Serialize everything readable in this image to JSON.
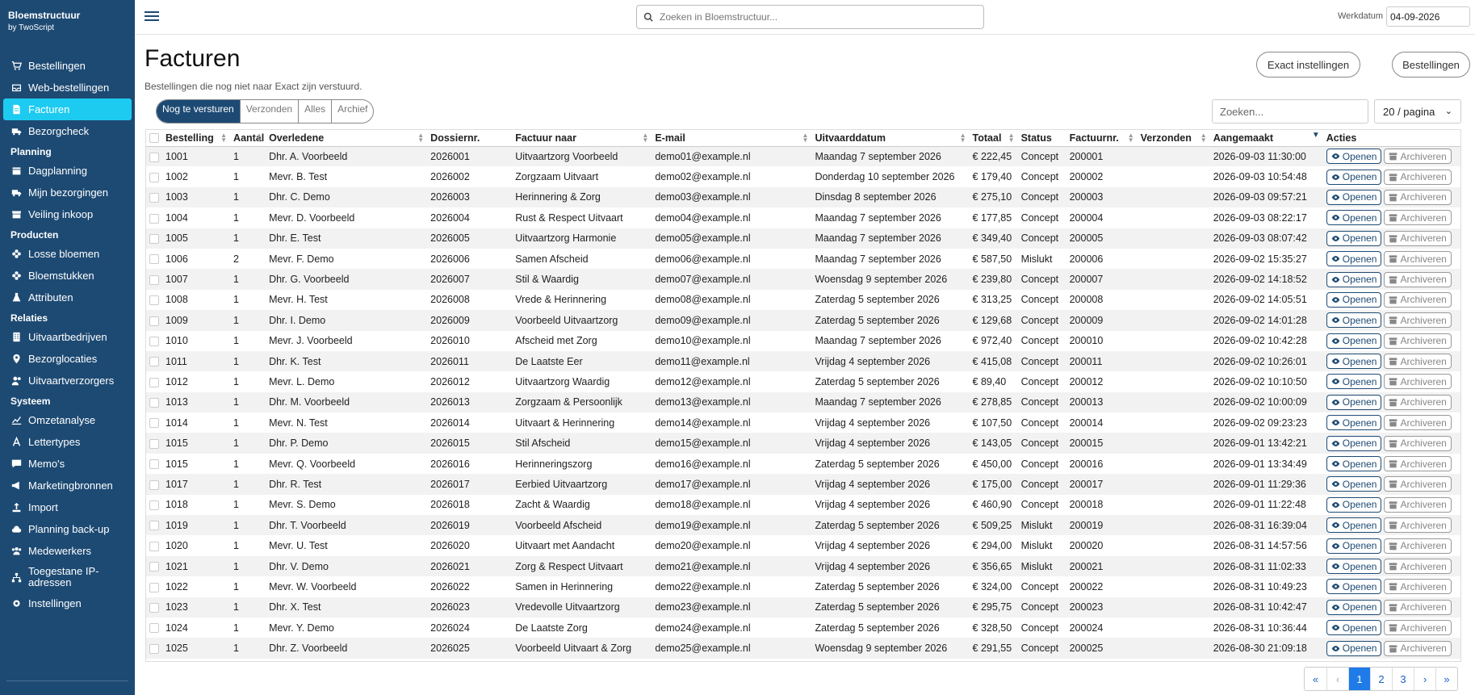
{
  "brand": {
    "name": "Bloemstructuur",
    "sub": "by TwoScript"
  },
  "nav": {
    "top": [
      {
        "label": "Bestellingen"
      },
      {
        "label": "Web-bestellingen"
      },
      {
        "label": "Facturen"
      },
      {
        "label": "Bezorgcheck"
      }
    ],
    "planning_title": "Planning",
    "planning": [
      {
        "label": "Dagplanning"
      },
      {
        "label": "Mijn bezorgingen"
      },
      {
        "label": "Veiling inkoop"
      }
    ],
    "producten_title": "Producten",
    "producten": [
      {
        "label": "Losse bloemen"
      },
      {
        "label": "Bloemstukken"
      },
      {
        "label": "Attributen"
      }
    ],
    "relaties_title": "Relaties",
    "relaties": [
      {
        "label": "Uitvaartbedrijven"
      },
      {
        "label": "Bezorglocaties"
      },
      {
        "label": "Uitvaartverzorgers"
      }
    ],
    "systeem_title": "Systeem",
    "systeem": [
      {
        "label": "Omzetanalyse"
      },
      {
        "label": "Lettertypes"
      },
      {
        "label": "Memo's"
      },
      {
        "label": "Marketingbronnen"
      },
      {
        "label": "Import"
      },
      {
        "label": "Planning back-up"
      },
      {
        "label": "Medewerkers"
      },
      {
        "label": "Toegestane IP-adressen"
      },
      {
        "label": "Instellingen"
      }
    ]
  },
  "topbar": {
    "search_placeholder": "Zoeken in Bloemstructuur...",
    "werkdatum_label": "Werkdatum",
    "werkdatum_value": "04-09-2026"
  },
  "page": {
    "title": "Facturen",
    "subtitle": "Bestellingen die nog niet naar Exact zijn verstuurd.",
    "btn_exact": "Exact instellingen",
    "btn_bestellingen": "Bestellingen"
  },
  "tabs": [
    "Nog te versturen",
    "Verzonden",
    "Alles",
    "Archief"
  ],
  "table_search_placeholder": "Zoeken...",
  "per_page": "20 / pagina",
  "columns": [
    "Bestelling",
    "Aantal",
    "Overledene",
    "Dossiernr.",
    "Factuur naar",
    "E-mail",
    "Uitvaarddatum",
    "Totaal",
    "Status",
    "Factuurnr.",
    "Verzonden",
    "Aangemaakt",
    "Acties"
  ],
  "actions": {
    "open": "Openen",
    "archive": "Archiveren"
  },
  "rows": [
    [
      "1001",
      "1",
      "Dhr. A. Voorbeeld",
      "2026001",
      "Uitvaartzorg Voorbeeld",
      "demo01@example.nl",
      "Maandag 7 september 2026",
      "€ 222,45",
      "Concept",
      "200001",
      "",
      "2026-09-03 11:30:00"
    ],
    [
      "1002",
      "1",
      "Mevr. B. Test",
      "2026002",
      "Zorgzaam Uitvaart",
      "demo02@example.nl",
      "Donderdag 10 september 2026",
      "€ 179,40",
      "Concept",
      "200002",
      "",
      "2026-09-03 10:54:48"
    ],
    [
      "1003",
      "1",
      "Dhr. C. Demo",
      "2026003",
      "Herinnering & Zorg",
      "demo03@example.nl",
      "Dinsdag 8 september 2026",
      "€ 275,10",
      "Concept",
      "200003",
      "",
      "2026-09-03 09:57:21"
    ],
    [
      "1004",
      "1",
      "Mevr. D. Voorbeeld",
      "2026004",
      "Rust & Respect Uitvaart",
      "demo04@example.nl",
      "Maandag 7 september 2026",
      "€ 177,85",
      "Concept",
      "200004",
      "",
      "2026-09-03 08:22:17"
    ],
    [
      "1005",
      "1",
      "Dhr. E. Test",
      "2026005",
      "Uitvaartzorg Harmonie",
      "demo05@example.nl",
      "Maandag 7 september 2026",
      "€ 349,40",
      "Concept",
      "200005",
      "",
      "2026-09-03 08:07:42"
    ],
    [
      "1006",
      "2",
      "Mevr. F. Demo",
      "2026006",
      "Samen Afscheid",
      "demo06@example.nl",
      "Maandag 7 september 2026",
      "€ 587,50",
      "Mislukt",
      "200006",
      "",
      "2026-09-02 15:35:27"
    ],
    [
      "1007",
      "1",
      "Dhr. G. Voorbeeld",
      "2026007",
      "Stil & Waardig",
      "demo07@example.nl",
      "Woensdag 9 september 2026",
      "€ 239,80",
      "Concept",
      "200007",
      "",
      "2026-09-02 14:18:52"
    ],
    [
      "1008",
      "1",
      "Mevr. H. Test",
      "2026008",
      "Vrede & Herinnering",
      "demo08@example.nl",
      "Zaterdag 5 september 2026",
      "€ 313,25",
      "Concept",
      "200008",
      "",
      "2026-09-02 14:05:51"
    ],
    [
      "1009",
      "1",
      "Dhr. I. Demo",
      "2026009",
      "Voorbeeld Uitvaartzorg",
      "demo09@example.nl",
      "Zaterdag 5 september 2026",
      "€ 129,68",
      "Concept",
      "200009",
      "",
      "2026-09-02 14:01:28"
    ],
    [
      "1010",
      "1",
      "Mevr. J. Voorbeeld",
      "2026010",
      "Afscheid met Zorg",
      "demo10@example.nl",
      "Maandag 7 september 2026",
      "€ 972,40",
      "Concept",
      "200010",
      "",
      "2026-09-02 10:42:28"
    ],
    [
      "1011",
      "1",
      "Dhr. K. Test",
      "2026011",
      "De Laatste Eer",
      "demo11@example.nl",
      "Vrijdag 4 september 2026",
      "€ 415,08",
      "Concept",
      "200011",
      "",
      "2026-09-02 10:26:01"
    ],
    [
      "1012",
      "1",
      "Mevr. L. Demo",
      "2026012",
      "Uitvaartzorg Waardig",
      "demo12@example.nl",
      "Zaterdag 5 september 2026",
      "€ 89,40",
      "Concept",
      "200012",
      "",
      "2026-09-02 10:10:50"
    ],
    [
      "1013",
      "1",
      "Dhr. M. Voorbeeld",
      "2026013",
      "Zorgzaam & Persoonlijk",
      "demo13@example.nl",
      "Maandag 7 september 2026",
      "€ 278,85",
      "Concept",
      "200013",
      "",
      "2026-09-02 10:00:09"
    ],
    [
      "1014",
      "1",
      "Mevr. N. Test",
      "2026014",
      "Uitvaart & Herinnering",
      "demo14@example.nl",
      "Vrijdag 4 september 2026",
      "€ 107,50",
      "Concept",
      "200014",
      "",
      "2026-09-02 09:23:23"
    ],
    [
      "1015",
      "1",
      "Dhr. P. Demo",
      "2026015",
      "Stil Afscheid",
      "demo15@example.nl",
      "Vrijdag 4 september 2026",
      "€ 143,05",
      "Concept",
      "200015",
      "",
      "2026-09-01 13:42:21"
    ],
    [
      "1015",
      "1",
      "Mevr. Q. Voorbeeld",
      "2026016",
      "Herinneringszorg",
      "demo16@example.nl",
      "Zaterdag 5 september 2026",
      "€ 450,00",
      "Concept",
      "200016",
      "",
      "2026-09-01 13:34:49"
    ],
    [
      "1017",
      "1",
      "Dhr. R. Test",
      "2026017",
      "Eerbied Uitvaartzorg",
      "demo17@example.nl",
      "Vrijdag 4 september 2026",
      "€ 175,00",
      "Concept",
      "200017",
      "",
      "2026-09-01 11:29:36"
    ],
    [
      "1018",
      "1",
      "Mevr. S. Demo",
      "2026018",
      "Zacht & Waardig",
      "demo18@example.nl",
      "Vrijdag 4 september 2026",
      "€ 460,90",
      "Concept",
      "200018",
      "",
      "2026-09-01 11:22:48"
    ],
    [
      "1019",
      "1",
      "Dhr. T. Voorbeeld",
      "2026019",
      "Voorbeeld Afscheid",
      "demo19@example.nl",
      "Zaterdag 5 september 2026",
      "€ 509,25",
      "Mislukt",
      "200019",
      "",
      "2026-08-31 16:39:04"
    ],
    [
      "1020",
      "1",
      "Mevr. U. Test",
      "2026020",
      "Uitvaart met Aandacht",
      "demo20@example.nl",
      "Vrijdag 4 september 2026",
      "€ 294,00",
      "Mislukt",
      "200020",
      "",
      "2026-08-31 14:57:56"
    ],
    [
      "1021",
      "1",
      "Dhr. V. Demo",
      "2026021",
      "Zorg & Respect Uitvaart",
      "demo21@example.nl",
      "Vrijdag 4 september 2026",
      "€ 356,65",
      "Mislukt",
      "200021",
      "",
      "2026-08-31 11:02:33"
    ],
    [
      "1022",
      "1",
      "Mevr. W. Voorbeeld",
      "2026022",
      "Samen in Herinnering",
      "demo22@example.nl",
      "Zaterdag 5 september 2026",
      "€ 324,00",
      "Concept",
      "200022",
      "",
      "2026-08-31 10:49:23"
    ],
    [
      "1023",
      "1",
      "Dhr. X. Test",
      "2026023",
      "Vredevolle Uitvaartzorg",
      "demo23@example.nl",
      "Zaterdag 5 september 2026",
      "€ 295,75",
      "Concept",
      "200023",
      "",
      "2026-08-31 10:42:47"
    ],
    [
      "1024",
      "1",
      "Mevr. Y. Demo",
      "2026024",
      "De Laatste Zorg",
      "demo24@example.nl",
      "Zaterdag 5 september 2026",
      "€ 328,50",
      "Concept",
      "200024",
      "",
      "2026-08-31 10:36:44"
    ],
    [
      "1025",
      "1",
      "Dhr. Z. Voorbeeld",
      "2026025",
      "Voorbeeld Uitvaart & Zorg",
      "demo25@example.nl",
      "Woensdag 9 september 2026",
      "€ 291,55",
      "Concept",
      "200025",
      "",
      "2026-08-30 21:09:18"
    ]
  ],
  "pager": {
    "first": "«",
    "prev": "‹",
    "pages": [
      "1",
      "2",
      "3"
    ],
    "next": "›",
    "last": "»"
  },
  "colors": {
    "sidebar": "#1d4a73",
    "active": "#1ecbf0",
    "pager_active": "#1e7be8"
  },
  "icons": {
    "top": [
      "cart-icon",
      "inbox-icon",
      "invoice-icon",
      "truck-icon"
    ],
    "planning": [
      "calendar-icon",
      "truck-icon",
      "store-icon"
    ],
    "producten": [
      "flower-icon",
      "flower-icon",
      "flask-icon"
    ],
    "relaties": [
      "building-icon",
      "map-pin-icon",
      "users-icon"
    ],
    "systeem": [
      "chart-icon",
      "font-icon",
      "comment-icon",
      "megaphone-icon",
      "upload-icon",
      "cloud-icon",
      "team-icon",
      "network-icon",
      "gear-icon"
    ]
  }
}
